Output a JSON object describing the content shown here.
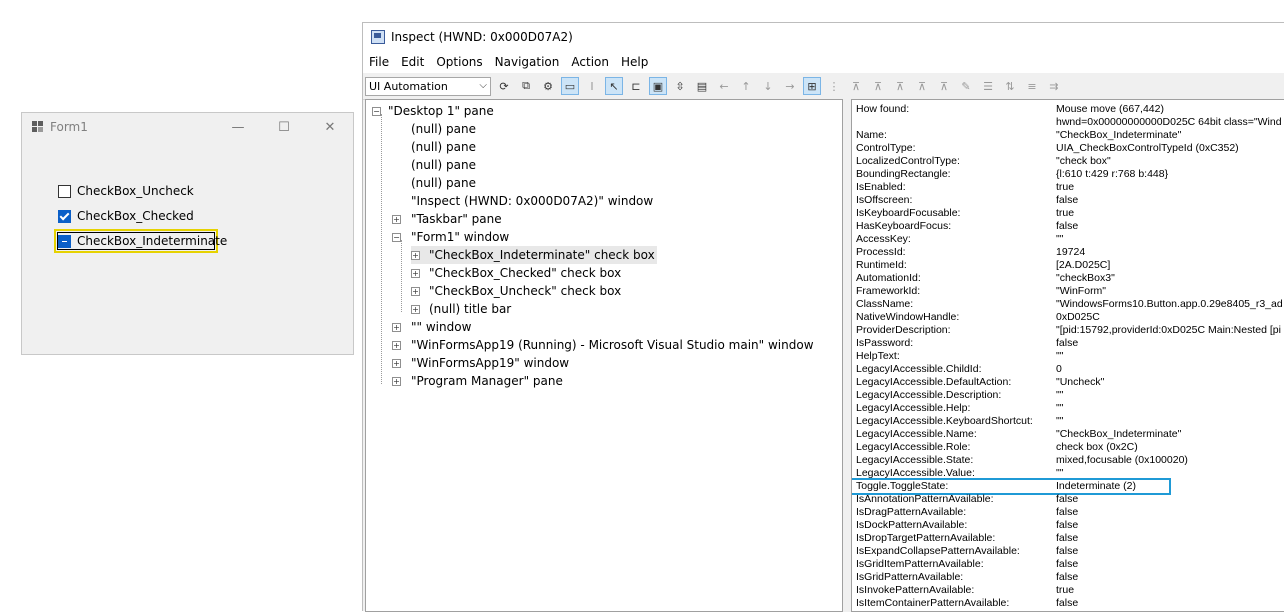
{
  "form1": {
    "title": "Form1",
    "buttons": {
      "minimize": "—",
      "maximize": "☐",
      "close": "✕"
    },
    "checkboxes": [
      {
        "label": "CheckBox_Uncheck",
        "state": "unchecked"
      },
      {
        "label": "CheckBox_Checked",
        "state": "checked"
      },
      {
        "label": "CheckBox_Indeterminate",
        "state": "indeterminate"
      }
    ]
  },
  "inspect": {
    "title": "Inspect  (HWND: 0x000D07A2)",
    "menu": [
      "File",
      "Edit",
      "Options",
      "Navigation",
      "Action",
      "Help"
    ],
    "mode": "UI Automation",
    "tree": [
      {
        "label": "\"Desktop 1\" pane",
        "expander": "−"
      },
      {
        "label": "(null) pane"
      },
      {
        "label": "(null) pane"
      },
      {
        "label": "(null) pane"
      },
      {
        "label": "(null) pane"
      },
      {
        "label": "\"Inspect  (HWND: 0x000D07A2)\" window"
      },
      {
        "label": "\"Taskbar\" pane",
        "expander": "+"
      },
      {
        "label": "\"Form1\" window",
        "expander": "−"
      },
      {
        "label": "\"CheckBox_Indeterminate\" check box",
        "expander": "+"
      },
      {
        "label": "\"CheckBox_Checked\" check box",
        "expander": "+"
      },
      {
        "label": "\"CheckBox_Uncheck\" check box",
        "expander": "+"
      },
      {
        "label": "(null) title bar",
        "expander": "+"
      },
      {
        "label": "\"\" window",
        "expander": "+"
      },
      {
        "label": "\"WinFormsApp19 (Running) - Microsoft Visual Studio main\" window",
        "expander": "+"
      },
      {
        "label": "\"WinFormsApp19\" window",
        "expander": "+"
      },
      {
        "label": "\"Program Manager\" pane",
        "expander": "+"
      }
    ],
    "properties": [
      [
        "How found:",
        "Mouse move (667,442)"
      ],
      [
        "",
        "hwnd=0x00000000000D025C 64bit class=\"Wind"
      ],
      [
        "Name:",
        "\"CheckBox_Indeterminate\""
      ],
      [
        "ControlType:",
        "UIA_CheckBoxControlTypeId (0xC352)"
      ],
      [
        "LocalizedControlType:",
        "\"check box\""
      ],
      [
        "BoundingRectangle:",
        "{l:610 t:429 r:768 b:448}"
      ],
      [
        "IsEnabled:",
        "true"
      ],
      [
        "IsOffscreen:",
        "false"
      ],
      [
        "IsKeyboardFocusable:",
        "true"
      ],
      [
        "HasKeyboardFocus:",
        "false"
      ],
      [
        "AccessKey:",
        "\"\""
      ],
      [
        "ProcessId:",
        "19724"
      ],
      [
        "RuntimeId:",
        "[2A.D025C]"
      ],
      [
        "AutomationId:",
        "\"checkBox3\""
      ],
      [
        "FrameworkId:",
        "\"WinForm\""
      ],
      [
        "ClassName:",
        "\"WindowsForms10.Button.app.0.29e8405_r3_ad"
      ],
      [
        "NativeWindowHandle:",
        "0xD025C"
      ],
      [
        "ProviderDescription:",
        "\"[pid:15792,providerId:0xD025C Main:Nested [pi"
      ],
      [
        "IsPassword:",
        "false"
      ],
      [
        "HelpText:",
        "\"\""
      ],
      [
        "LegacyIAccessible.ChildId:",
        "0"
      ],
      [
        "LegacyIAccessible.DefaultAction:",
        "\"Uncheck\""
      ],
      [
        "LegacyIAccessible.Description:",
        "\"\""
      ],
      [
        "LegacyIAccessible.Help:",
        "\"\""
      ],
      [
        "LegacyIAccessible.KeyboardShortcut:",
        "\"\""
      ],
      [
        "LegacyIAccessible.Name:",
        "\"CheckBox_Indeterminate\""
      ],
      [
        "LegacyIAccessible.Role:",
        "check box (0x2C)"
      ],
      [
        "LegacyIAccessible.State:",
        "mixed,focusable (0x100020)"
      ],
      [
        "LegacyIAccessible.Value:",
        "\"\""
      ],
      [
        "Toggle.ToggleState:",
        "Indeterminate (2)"
      ],
      [
        "IsAnnotationPatternAvailable:",
        "false"
      ],
      [
        "IsDragPatternAvailable:",
        "false"
      ],
      [
        "IsDockPatternAvailable:",
        "false"
      ],
      [
        "IsDropTargetPatternAvailable:",
        "false"
      ],
      [
        "IsExpandCollapsePatternAvailable:",
        "false"
      ],
      [
        "IsGridItemPatternAvailable:",
        "false"
      ],
      [
        "IsGridPatternAvailable:",
        "false"
      ],
      [
        "IsInvokePatternAvailable:",
        "true"
      ],
      [
        "IsItemContainerPatternAvailable:",
        "false"
      ]
    ]
  }
}
